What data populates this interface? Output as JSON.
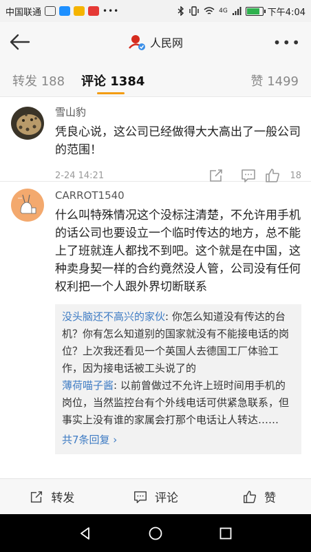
{
  "status_bar": {
    "carrier": "中国联通",
    "dots": "•••",
    "signal_label": "4G",
    "time": "下午4:04",
    "battery_level": 0.85,
    "battery_color": "#2fb14e"
  },
  "nav": {
    "title": "人民网",
    "more": "•••"
  },
  "tabs": [
    {
      "label": "转发 188"
    },
    {
      "label": "评论 1384",
      "active": true
    },
    {
      "label": "赞 1499"
    }
  ],
  "accent_color": "#f39c12",
  "link_color": "#3f7cc4",
  "comments": [
    {
      "user": "雪山豹",
      "text": "凭良心说，这公司已经做得大大高出了一般公司的范围！",
      "time": "2-24 14:21",
      "likes": "18"
    },
    {
      "user": "CARROT1540",
      "text": "什么叫特殊情况这个没标注清楚，不允许用手机的话公司也要设立一个临时传达的地方，总不能上了班就连人都找不到吧。这个就是在中国，这种卖身契一样的合约竟然没人管，公司没有任何权利把一个人跟外界切断联系",
      "replies": [
        {
          "author": "没头脑还不高兴的家伙",
          "text": ": 你怎么知道没有传达的台机？你有怎么知道别的国家就没有不能接电话的岗位？上次我还看见一个英国人去德国工厂体验工作，因为接电话被工头说了的"
        },
        {
          "author": "薄荷喵子酱",
          "text": ": 以前曾做过不允许上班时间用手机的岗位，当然监控台有个外线电话可供紧急联系，但事实上没有谁的家属会打那个电话让人转达……"
        }
      ],
      "more_replies": "共7条回复 ›"
    }
  ],
  "action_bar": {
    "repost": "转发",
    "comment": "评论",
    "like": "赞"
  }
}
